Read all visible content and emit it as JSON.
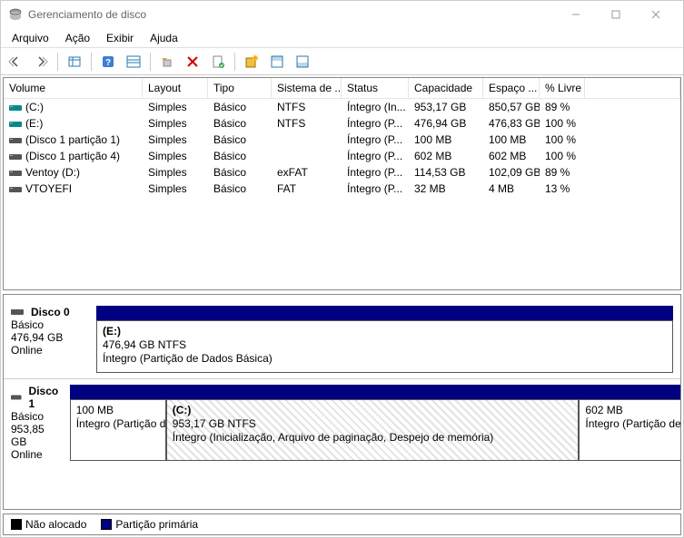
{
  "window": {
    "title": "Gerenciamento de disco"
  },
  "menu": {
    "file": "Arquivo",
    "action": "Ação",
    "view": "Exibir",
    "help": "Ajuda"
  },
  "columns": {
    "volume": "Volume",
    "layout": "Layout",
    "type": "Tipo",
    "filesystem": "Sistema de ...",
    "status": "Status",
    "capacity": "Capacidade",
    "free": "Espaço ...",
    "pctfree": "% Livre"
  },
  "volumes": [
    {
      "icon": "teal",
      "name": "(C:)",
      "layout": "Simples",
      "type": "Básico",
      "fs": "NTFS",
      "status": "Íntegro (In...",
      "cap": "953,17 GB",
      "free": "850,57 GB",
      "pct": "89 %"
    },
    {
      "icon": "teal",
      "name": "(E:)",
      "layout": "Simples",
      "type": "Básico",
      "fs": "NTFS",
      "status": "Íntegro (P...",
      "cap": "476,94 GB",
      "free": "476,83 GB",
      "pct": "100 %"
    },
    {
      "icon": "dark",
      "name": "(Disco 1 partição 1)",
      "layout": "Simples",
      "type": "Básico",
      "fs": "",
      "status": "Íntegro (P...",
      "cap": "100 MB",
      "free": "100 MB",
      "pct": "100 %"
    },
    {
      "icon": "dark",
      "name": "(Disco 1 partição 4)",
      "layout": "Simples",
      "type": "Básico",
      "fs": "",
      "status": "Íntegro (P...",
      "cap": "602 MB",
      "free": "602 MB",
      "pct": "100 %"
    },
    {
      "icon": "dark",
      "name": "Ventoy (D:)",
      "layout": "Simples",
      "type": "Básico",
      "fs": "exFAT",
      "status": "Íntegro (P...",
      "cap": "114,53 GB",
      "free": "102,09 GB",
      "pct": "89 %"
    },
    {
      "icon": "dark",
      "name": "VTOYEFI",
      "layout": "Simples",
      "type": "Básico",
      "fs": "FAT",
      "status": "Íntegro (P...",
      "cap": "32 MB",
      "free": "4 MB",
      "pct": "13 %"
    }
  ],
  "disks": [
    {
      "name": "Disco 0",
      "type": "Básico",
      "size": "476,94 GB",
      "state": "Online",
      "parts": [
        {
          "width": "100%",
          "hatched": false,
          "label": "(E:)",
          "sub1": "476,94 GB NTFS",
          "sub2": "Íntegro (Partição de Dados Básica)"
        }
      ]
    },
    {
      "name": "Disco 1",
      "type": "Básico",
      "size": "953,85 GB",
      "state": "Online",
      "parts": [
        {
          "width": "14%",
          "hatched": false,
          "label": "",
          "sub1": "100 MB",
          "sub2": "Íntegro (Partição de Sistema EFI)"
        },
        {
          "width": "60%",
          "hatched": true,
          "label": "(C:)",
          "sub1": "953,17 GB NTFS",
          "sub2": "Íntegro (Inicialização, Arquivo de paginação, Despejo de memória)"
        },
        {
          "width": "26%",
          "hatched": false,
          "label": "",
          "sub1": "602 MB",
          "sub2": "Íntegro (Partição de Recuperação)"
        }
      ]
    }
  ],
  "legend": {
    "unallocated": "Não alocado",
    "primary": "Partição primária"
  }
}
